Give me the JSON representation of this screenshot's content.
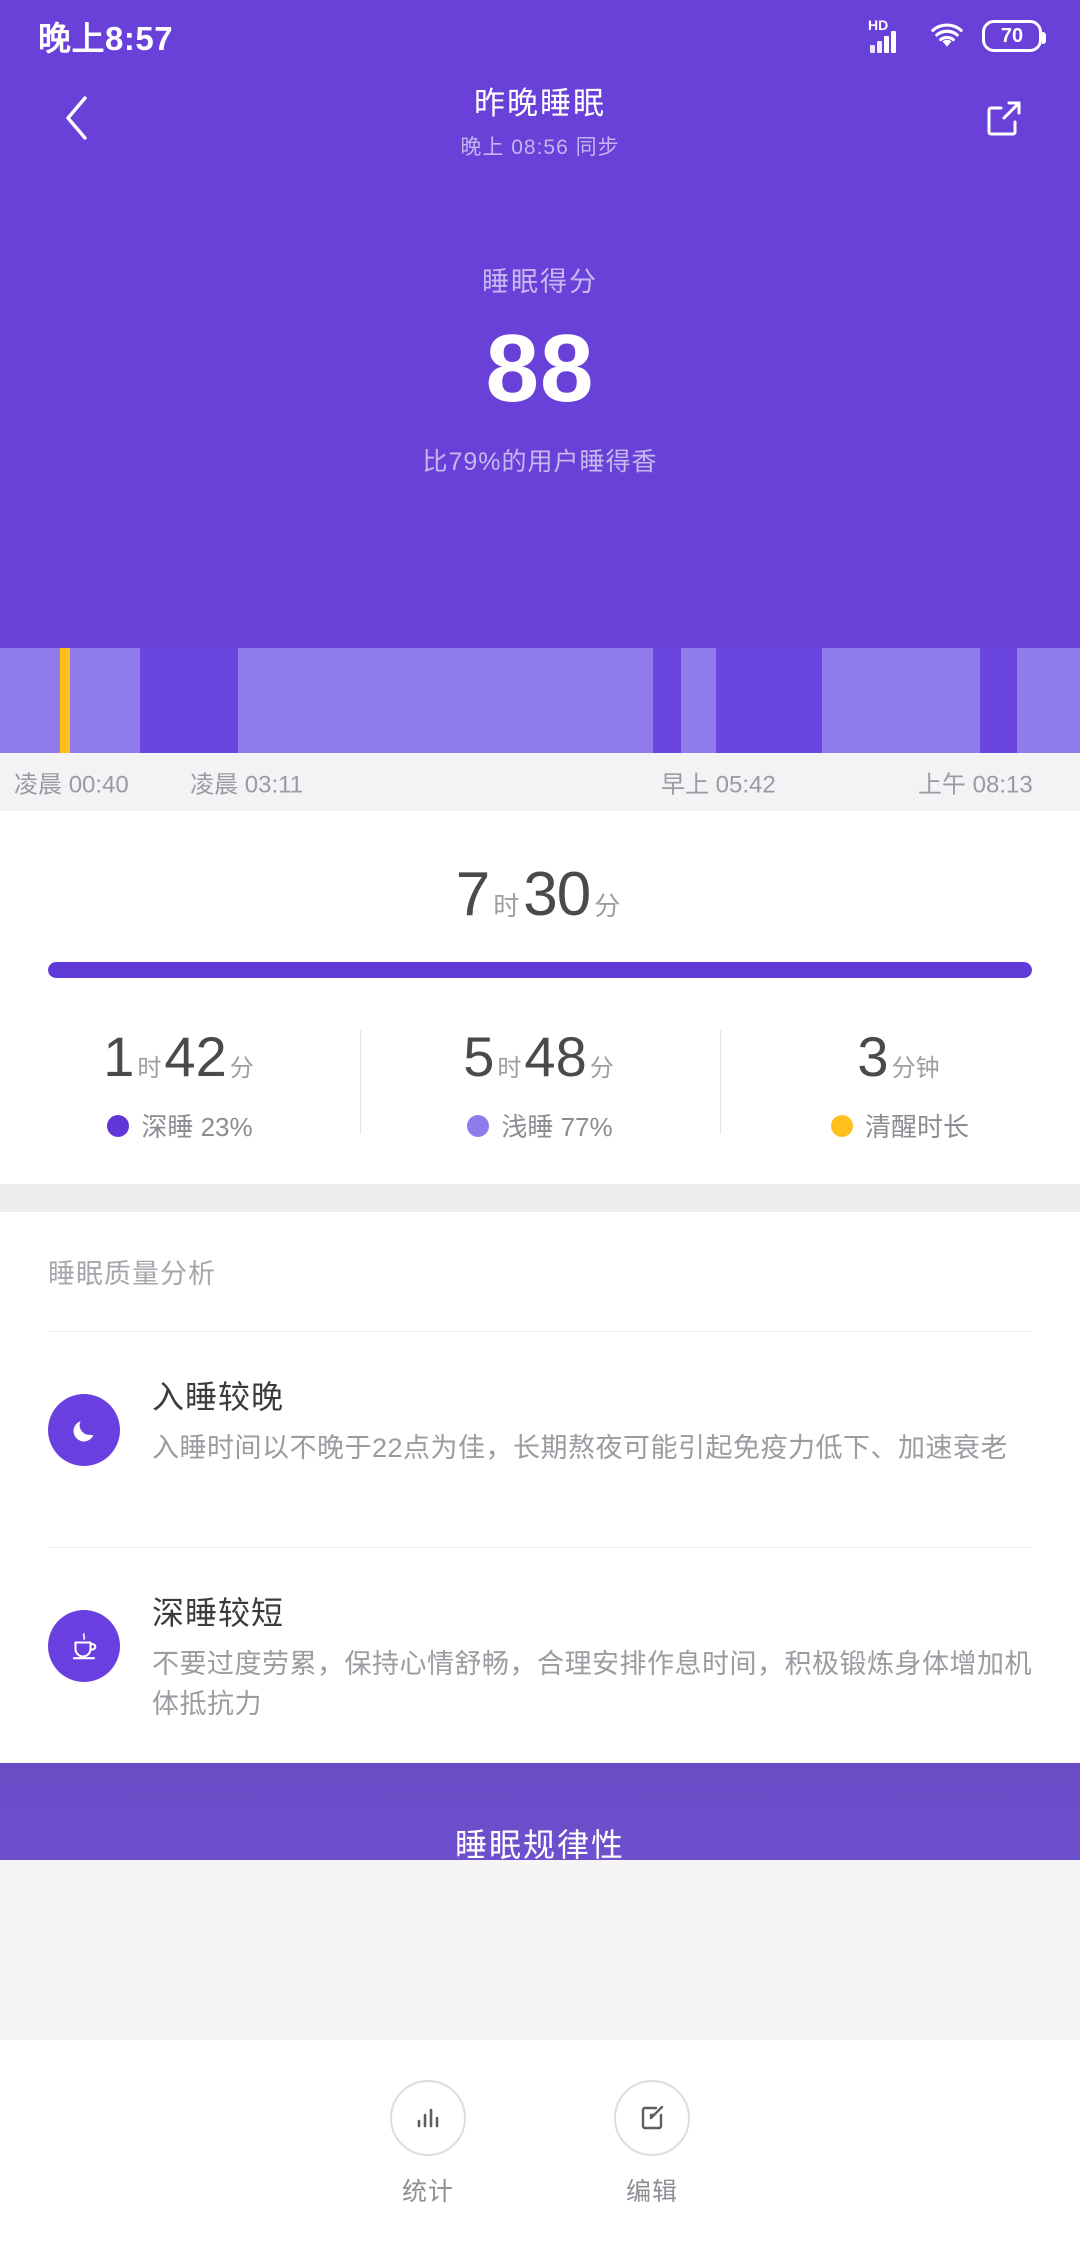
{
  "statusbar": {
    "time": "晚上8:57",
    "network_badge": "HD",
    "battery": "70",
    "signal_icon": "signal-bars-icon",
    "wifi_icon": "wifi-icon",
    "battery_icon": "battery-icon"
  },
  "navbar": {
    "back_icon": "chevron-left-icon",
    "title": "昨晚睡眠",
    "subtitle": "晚上 08:56 同步",
    "share_icon": "share-icon"
  },
  "hero": {
    "score_label": "睡眠得分",
    "score_value": "88",
    "compare_text": "比79%的用户睡得香"
  },
  "chart_data": {
    "type": "bar",
    "title": "睡眠阶段时间轴",
    "xlabel": "",
    "ylabel": "",
    "grid": false,
    "legend_position": "below",
    "axis_ticks": [
      {
        "label": "凌晨 00:40",
        "pos_pct": 1.3
      },
      {
        "label": "凌晨 03:11",
        "pos_pct": 17.6
      },
      {
        "label": "早上 05:42",
        "pos_pct": 61.2
      },
      {
        "label": "上午 08:13",
        "pos_pct": 85.0
      }
    ],
    "categories": [
      "浅睡",
      "清醒",
      "深睡"
    ],
    "series": [
      {
        "name": "深睡",
        "label": "深睡 23%",
        "color": "#6135d6",
        "value_pct": 23,
        "duration": "1时42分"
      },
      {
        "name": "浅睡",
        "label": "浅睡 77%",
        "color": "#8f7bec",
        "value_pct": 77,
        "duration": "5时48分"
      },
      {
        "name": "清醒时长",
        "label": "清醒时长",
        "color": "#ffc01e",
        "value_pct": 0.7,
        "duration": "3分钟"
      }
    ],
    "segments": [
      {
        "stage": "浅睡",
        "color": "#8f7bec",
        "start_pct": 0.0,
        "width_pct": 5.6
      },
      {
        "stage": "清醒",
        "color": "#ffc01e",
        "start_pct": 5.6,
        "width_pct": 0.9
      },
      {
        "stage": "浅睡",
        "color": "#8f7bec",
        "start_pct": 6.5,
        "width_pct": 6.5
      },
      {
        "stage": "深睡",
        "color": "#6a46de",
        "start_pct": 13.0,
        "width_pct": 9.0
      },
      {
        "stage": "浅睡",
        "color": "#8f7bec",
        "start_pct": 22.0,
        "width_pct": 38.5
      },
      {
        "stage": "深睡",
        "color": "#6a46de",
        "start_pct": 60.5,
        "width_pct": 2.6
      },
      {
        "stage": "浅睡",
        "color": "#8f7bec",
        "start_pct": 63.1,
        "width_pct": 3.2
      },
      {
        "stage": "深睡",
        "color": "#6a46de",
        "start_pct": 66.3,
        "width_pct": 9.8
      },
      {
        "stage": "浅睡",
        "color": "#8f7bec",
        "start_pct": 76.1,
        "width_pct": 14.6
      },
      {
        "stage": "深睡",
        "color": "#6a46de",
        "start_pct": 90.7,
        "width_pct": 3.5
      },
      {
        "stage": "浅睡",
        "color": "#8f7bec",
        "start_pct": 94.2,
        "width_pct": 5.8
      }
    ]
  },
  "summary": {
    "total": {
      "hours": "7",
      "hours_unit": "时",
      "minutes": "30",
      "minutes_unit": "分"
    },
    "progress_pct": 100,
    "stats": [
      {
        "value_major": "1",
        "unit_major": "时",
        "value_minor": "42",
        "unit_minor": "分",
        "legend": "深睡 23%",
        "color": "#6135d6",
        "dot_name": "deep-sleep-dot"
      },
      {
        "value_major": "5",
        "unit_major": "时",
        "value_minor": "48",
        "unit_minor": "分",
        "legend": "浅睡 77%",
        "color": "#8f7bec",
        "dot_name": "light-sleep-dot"
      },
      {
        "value_major": "3",
        "unit_major": "分钟",
        "value_minor": "",
        "unit_minor": "",
        "legend": "清醒时长",
        "color": "#ffc01e",
        "dot_name": "awake-dot"
      }
    ]
  },
  "analysis": {
    "title": "睡眠质量分析",
    "tips": [
      {
        "icon": "moon-icon",
        "heading": "入睡较晚",
        "text": "入睡时间以不晚于22点为佳，长期熬夜可能引起免疫力低下、加速衰老"
      },
      {
        "icon": "coffee-cup-icon",
        "heading": "深睡较短",
        "text": "不要过度劳累，保持心情舒畅，合理安排作息时间，积极锻炼身体增加机体抵抗力"
      }
    ]
  },
  "regularity": {
    "title": "睡眠规律性"
  },
  "bottombar": {
    "items": [
      {
        "label": "统计",
        "icon": "bar-chart-icon"
      },
      {
        "label": "编辑",
        "icon": "edit-pencil-icon"
      }
    ]
  },
  "colors": {
    "brand_purple": "#6a41d8",
    "deep_sleep": "#6135d6",
    "light_sleep": "#8f7bec",
    "awake": "#ffc01e"
  }
}
